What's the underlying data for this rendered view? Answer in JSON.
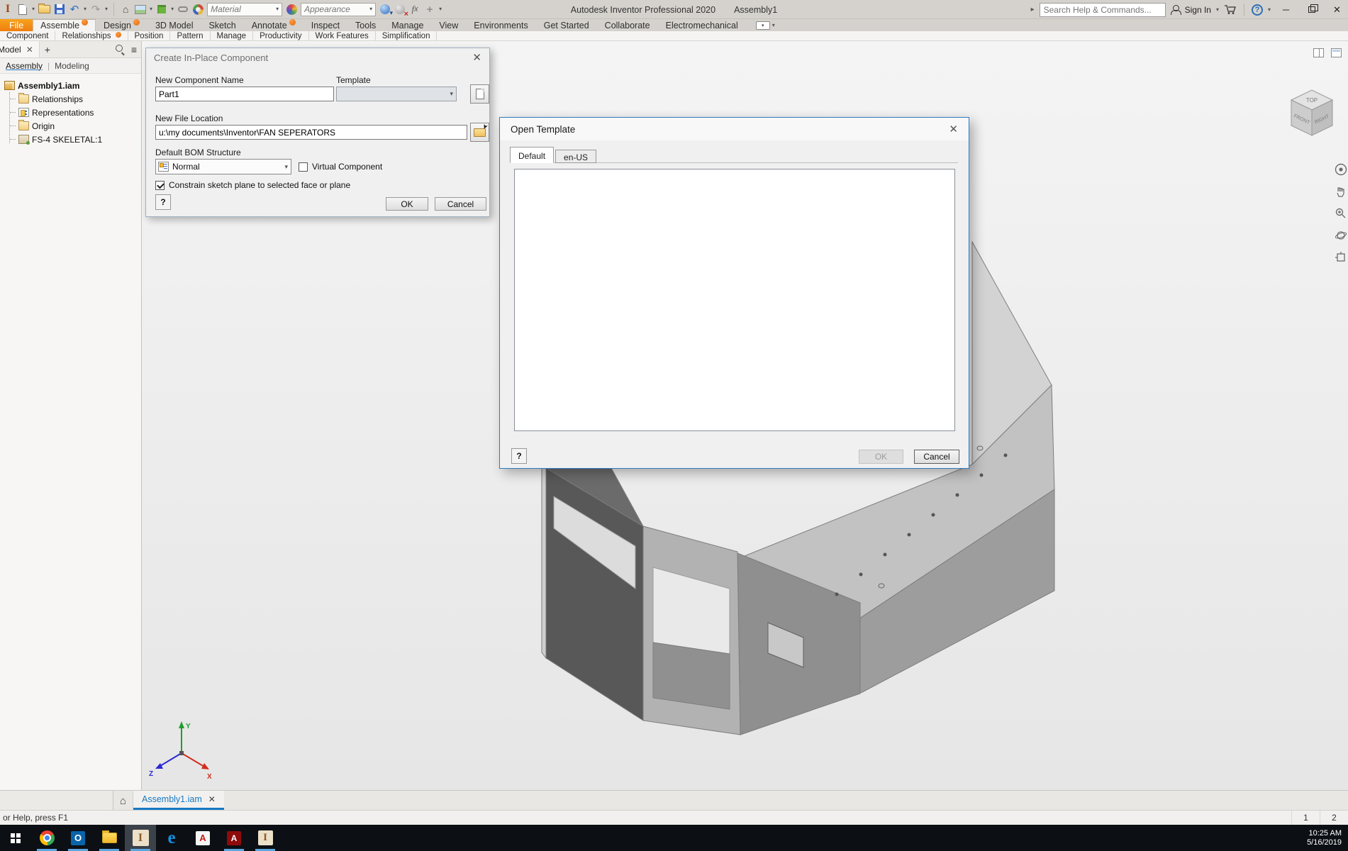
{
  "window": {
    "app_title": "Autodesk Inventor Professional 2020",
    "doc_title": "Assembly1"
  },
  "qat": {
    "material_label": "Material",
    "appearance_label": "Appearance"
  },
  "infocenter": {
    "search_placeholder": "Search Help & Commands...",
    "sign_in_label": "Sign In"
  },
  "ribbon": {
    "file_label": "File",
    "tabs": [
      {
        "label": "Assemble",
        "badge": true,
        "active": true
      },
      {
        "label": "Design",
        "badge": true
      },
      {
        "label": "3D Model"
      },
      {
        "label": "Sketch"
      },
      {
        "label": "Annotate",
        "badge": true
      },
      {
        "label": "Inspect"
      },
      {
        "label": "Tools"
      },
      {
        "label": "Manage"
      },
      {
        "label": "View"
      },
      {
        "label": "Environments"
      },
      {
        "label": "Get Started"
      },
      {
        "label": "Collaborate"
      },
      {
        "label": "Electromechanical"
      }
    ],
    "panels": [
      {
        "label": "Component"
      },
      {
        "label": "Relationships",
        "badge": true
      },
      {
        "label": "Position"
      },
      {
        "label": "Pattern"
      },
      {
        "label": "Manage"
      },
      {
        "label": "Productivity"
      },
      {
        "label": "Work Features"
      },
      {
        "label": "Simplification"
      }
    ]
  },
  "browser": {
    "tab_label": "Model",
    "view_assembly": "Assembly",
    "view_modeling": "Modeling",
    "tree": [
      {
        "icon": "assembly",
        "label": "Assembly1.iam",
        "bold": true,
        "root": true
      },
      {
        "icon": "folder",
        "label": "Relationships"
      },
      {
        "icon": "representations",
        "label": "Representations"
      },
      {
        "icon": "folder",
        "label": "Origin"
      },
      {
        "icon": "part",
        "label": "FS-4 SKELETAL:1"
      }
    ]
  },
  "create_dialog": {
    "title": "Create In-Place Component",
    "name_label": "New Component Name",
    "name_value": "Part1",
    "template_label": "Template",
    "location_label": "New File Location",
    "location_value": "u:\\my documents\\Inventor\\FAN SEPERATORS",
    "bom_label": "Default BOM Structure",
    "bom_value": "Normal",
    "virtual_label": "Virtual Component",
    "constrain_label": "Constrain sketch plane to selected face or plane",
    "help_label": "?",
    "ok_label": "OK",
    "cancel_label": "Cancel"
  },
  "open_template_dialog": {
    "title": "Open Template",
    "tabs": [
      {
        "label": "Default",
        "active": true
      },
      {
        "label": "en-US"
      }
    ],
    "help_label": "?",
    "ok_label": "OK",
    "cancel_label": "Cancel"
  },
  "viewcube": {
    "top": "TOP",
    "front": "FRONT",
    "right": "RIGHT"
  },
  "doc_tab": {
    "label": "Assembly1.iam"
  },
  "status_bar": {
    "left_text": "or Help, press F1",
    "cell1": "1",
    "cell2": "2"
  },
  "taskbar": {
    "time": "10:25 AM",
    "date": "5/16/2019",
    "icons": [
      {
        "kind": "chrome",
        "running": true
      },
      {
        "kind": "outlook",
        "running": true
      },
      {
        "kind": "explorer",
        "running": true
      },
      {
        "kind": "inventor",
        "running": true,
        "active": true
      },
      {
        "kind": "edge"
      },
      {
        "kind": "autodesk"
      },
      {
        "kind": "acrobat",
        "running": true
      },
      {
        "kind": "inventor2",
        "running": true
      }
    ]
  },
  "colors": {
    "accent_orange": "#e87722",
    "selection_blue": "#1779c4"
  }
}
